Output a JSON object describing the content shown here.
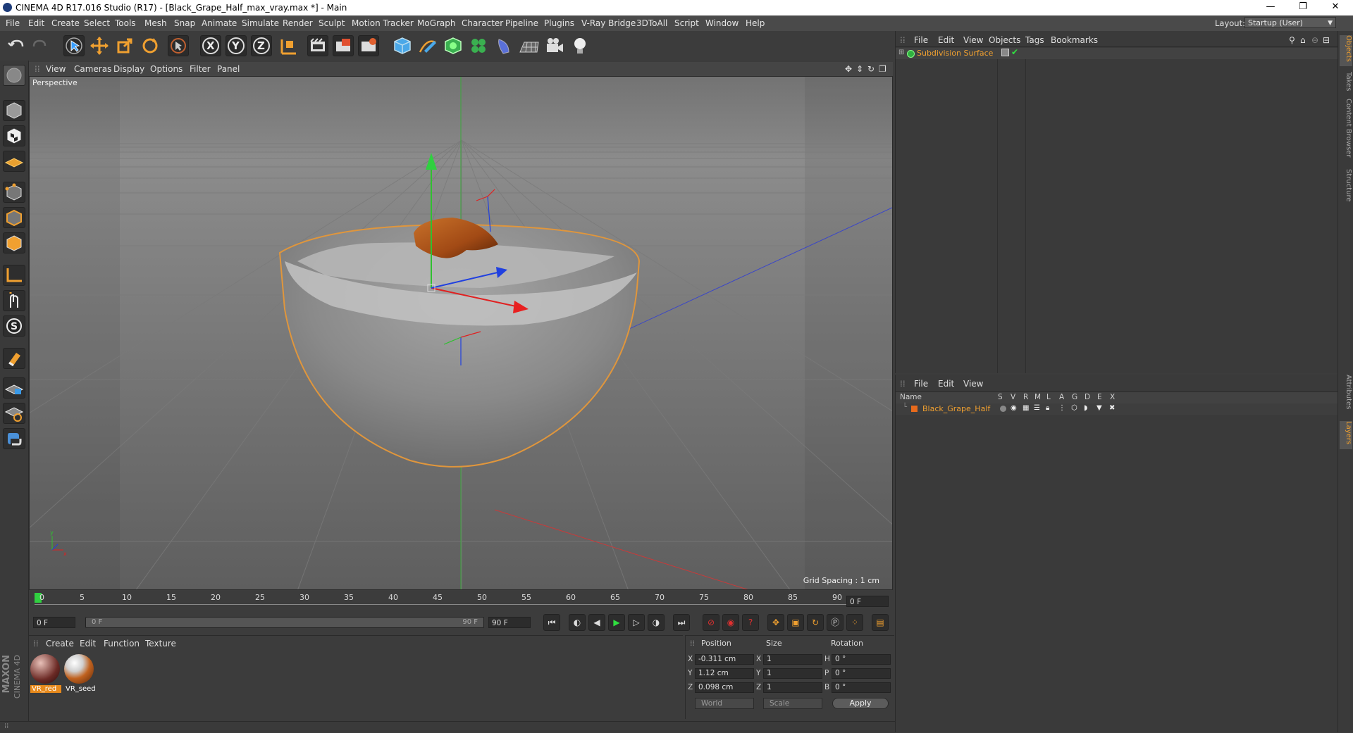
{
  "window": {
    "title": "CINEMA 4D R17.016 Studio (R17) - [Black_Grape_Half_max_vray.max *] - Main",
    "minimize": "—",
    "restore": "❐",
    "close": "✕"
  },
  "menubar": {
    "items": [
      "File",
      "Edit",
      "Create",
      "Select",
      "Tools",
      "Mesh",
      "Snap",
      "Animate",
      "Simulate",
      "Render",
      "Sculpt",
      "Motion Tracker",
      "MoGraph",
      "Character",
      "Pipeline",
      "Plugins",
      "V-Ray Bridge",
      "3DToAll",
      "Script",
      "Window",
      "Help"
    ],
    "layout_label": "Layout:",
    "layout_value": "Startup (User)"
  },
  "toolbar": {
    "icons": [
      "undo-icon",
      "redo-icon",
      "live-selection-icon",
      "move-icon",
      "scale-icon",
      "rotate-icon",
      "recent-tool-icon",
      "x-axis-icon",
      "y-axis-icon",
      "z-axis-icon",
      "world-coordinates-icon",
      "render-view-icon",
      "render-picture-viewer-icon",
      "edit-render-settings-icon",
      "cube-icon",
      "pen-icon",
      "subdivision-icon",
      "cloner-icon",
      "deformer-icon",
      "floor-icon",
      "camera-icon",
      "light-icon"
    ],
    "axis_labels": [
      "X",
      "Y",
      "Z"
    ]
  },
  "viewport": {
    "menu": [
      "View",
      "Cameras",
      "Display",
      "Options",
      "Filter",
      "Panel"
    ],
    "label": "Perspective",
    "grid_spacing": "Grid Spacing : 1 cm"
  },
  "timeline": {
    "ticks": [
      "0",
      "5",
      "10",
      "15",
      "20",
      "25",
      "30",
      "35",
      "40",
      "45",
      "50",
      "55",
      "60",
      "65",
      "70",
      "75",
      "80",
      "85",
      "90"
    ],
    "current_frame": "0 F",
    "start_frame": "0 F",
    "range_start": "0 F",
    "range_end": "90 F",
    "end_frame": "90 F"
  },
  "material_manager": {
    "menu": [
      "Create",
      "Edit",
      "Function",
      "Texture"
    ],
    "materials": [
      {
        "name": "VR_red",
        "color": "#6b2a25"
      },
      {
        "name": "VR_seed",
        "color": "#c0621f"
      }
    ],
    "brand_line1": "MAXON",
    "brand_line2": "CINEMA 4D"
  },
  "coordinates": {
    "headers": [
      "Position",
      "Size",
      "Rotation"
    ],
    "rows": [
      {
        "axis": "X",
        "pos": "-0.311 cm",
        "size_axis": "X",
        "size": "1",
        "rot_axis": "H",
        "rot": "0 °"
      },
      {
        "axis": "Y",
        "pos": "1.12 cm",
        "size_axis": "Y",
        "size": "1",
        "rot_axis": "P",
        "rot": "0 °"
      },
      {
        "axis": "Z",
        "pos": "0.098 cm",
        "size_axis": "Z",
        "size": "1",
        "rot_axis": "B",
        "rot": "0 °"
      }
    ],
    "space": "World",
    "mode": "Scale",
    "apply": "Apply"
  },
  "object_manager": {
    "menu": [
      "File",
      "Edit",
      "View",
      "Objects",
      "Tags",
      "Bookmarks"
    ],
    "objects": [
      {
        "name": "Subdivision Surface"
      }
    ]
  },
  "layer_manager": {
    "menu": [
      "File",
      "Edit",
      "View"
    ],
    "columns": [
      "Name",
      "S",
      "V",
      "R",
      "M",
      "L",
      "A",
      "G",
      "D",
      "E",
      "X"
    ],
    "layers": [
      {
        "name": "Black_Grape_Half",
        "color": "#e86a1c"
      }
    ]
  },
  "side_tabs": [
    "Objects",
    "Takes",
    "Content Browser",
    "Structure",
    "Attributes",
    "Layers"
  ],
  "colors": {
    "accent_orange": "#f0a030",
    "selection_outline": "#e0963c",
    "axis_x": "#e02020",
    "axis_y": "#20c040",
    "axis_z": "#2030d0"
  }
}
